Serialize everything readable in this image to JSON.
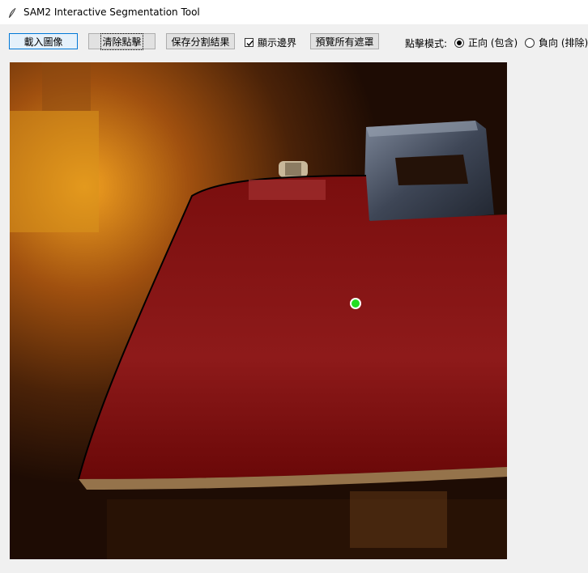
{
  "window": {
    "title": "SAM2 Interactive Segmentation Tool",
    "icon": "feather-icon"
  },
  "toolbar": {
    "load_image": "載入圖像",
    "clear_points": "清除點擊",
    "save_result": "保存分割結果",
    "show_border_label": "顯示邊界",
    "show_border_checked": true,
    "preview_masks": "預覽所有遮罩",
    "mode_label": "點擊模式:",
    "mode_positive": "正向 (包含)",
    "mode_negative": "負向 (排除)",
    "selected_mode": "positive"
  },
  "canvas": {
    "mask_color": "#7a0d0d",
    "point_color": "#22dd22",
    "points": [
      {
        "type": "positive"
      }
    ]
  }
}
